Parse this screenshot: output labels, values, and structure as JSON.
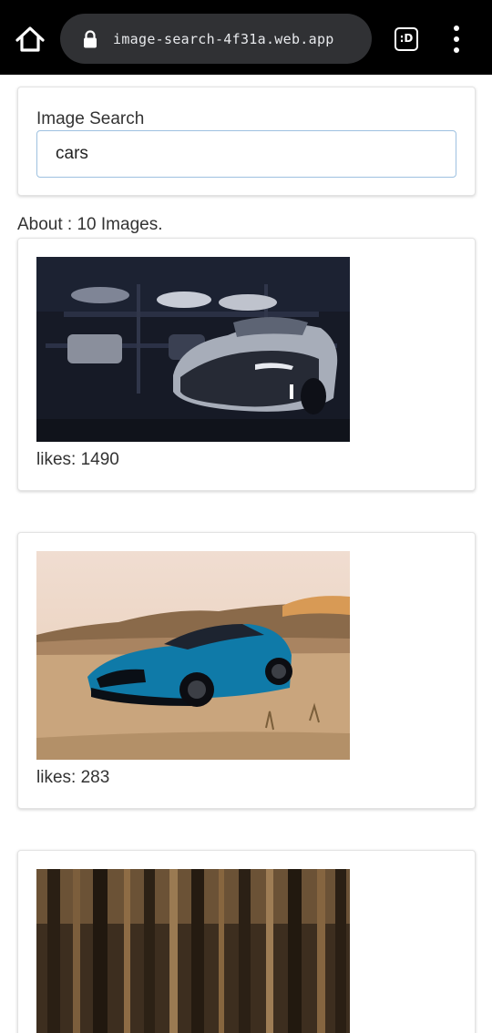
{
  "browser": {
    "url": "image-search-4f31a.web.app",
    "tabs_label": ":D"
  },
  "search": {
    "label": "Image Search",
    "value": "cars"
  },
  "results": {
    "about": "About : 10 Images.",
    "items": [
      {
        "likes_label": "likes: 1490",
        "icon": "photo-dark-garage-car"
      },
      {
        "likes_label": "likes: 283",
        "icon": "photo-blue-car-desert"
      },
      {
        "likes_label": "",
        "icon": "photo-forest"
      }
    ]
  }
}
